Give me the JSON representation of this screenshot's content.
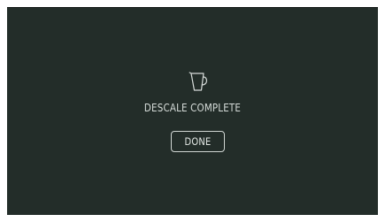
{
  "screen": {
    "background_color": "#232d29",
    "icon": "milk-pitcher-icon",
    "message": "DESCALE COMPLETE",
    "done_label": "DONE"
  }
}
